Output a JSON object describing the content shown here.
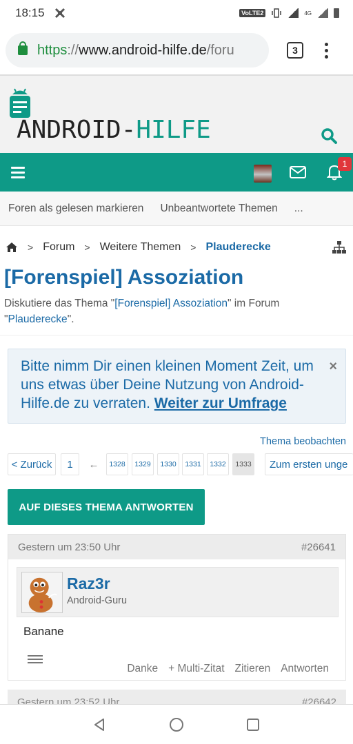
{
  "status_bar": {
    "time": "18:15",
    "volte": "VoLTE2",
    "net": "4G"
  },
  "browser": {
    "url_scheme": "https",
    "url_sep": "://",
    "url_host": "www.android-hilfe.de",
    "url_path": "/foru",
    "tab_count": "3"
  },
  "site": {
    "logo_part1": "ANDROID-",
    "logo_part2": "HILFE",
    "accent": "#0e9a87",
    "link_color": "#1b6aa6",
    "alert_count": "1"
  },
  "subnav": {
    "items": [
      "Foren als gelesen markieren",
      "Unbeantwortete Themen",
      "..."
    ]
  },
  "breadcrumb": {
    "items": [
      "Forum",
      "Weitere Themen"
    ],
    "current": "Plauderecke"
  },
  "thread": {
    "title": "[Forenspiel] Assoziation",
    "desc_prefix": "Diskutiere das Thema \"",
    "desc_thread_link": "[Forenspiel] Assoziation",
    "desc_middle": "\" im Forum \"",
    "desc_forum_link": "Plauderecke",
    "desc_suffix": "\"."
  },
  "notice": {
    "text": "Bitte nimm Dir einen kleinen Moment Zeit, um uns etwas über Deine Nutzung von Android-Hilfe.de zu verraten.",
    "link": "Weiter zur Umfrage",
    "close": "×"
  },
  "watch_label": "Thema beobachten",
  "pager": {
    "prev": "< Zurück",
    "first": "1",
    "ellipsis": "←",
    "pages": [
      "1328",
      "1329",
      "1330",
      "1331",
      "1332",
      "1333"
    ],
    "current": "1333",
    "first_unread": "Zum ersten unge"
  },
  "reply_button": "AUF DIESES THEMA ANTWORTEN",
  "post": {
    "date": "Gestern um 23:50 Uhr",
    "number": "#26641",
    "user_name": "Raz3r",
    "user_title": "Android-Guru",
    "body": "Banane",
    "actions": [
      "Danke",
      "+ Multi-Zitat",
      "Zitieren",
      "Antworten"
    ]
  },
  "post2": {
    "date": "Gestern um 23:52 Uhr",
    "number": "#26642"
  }
}
